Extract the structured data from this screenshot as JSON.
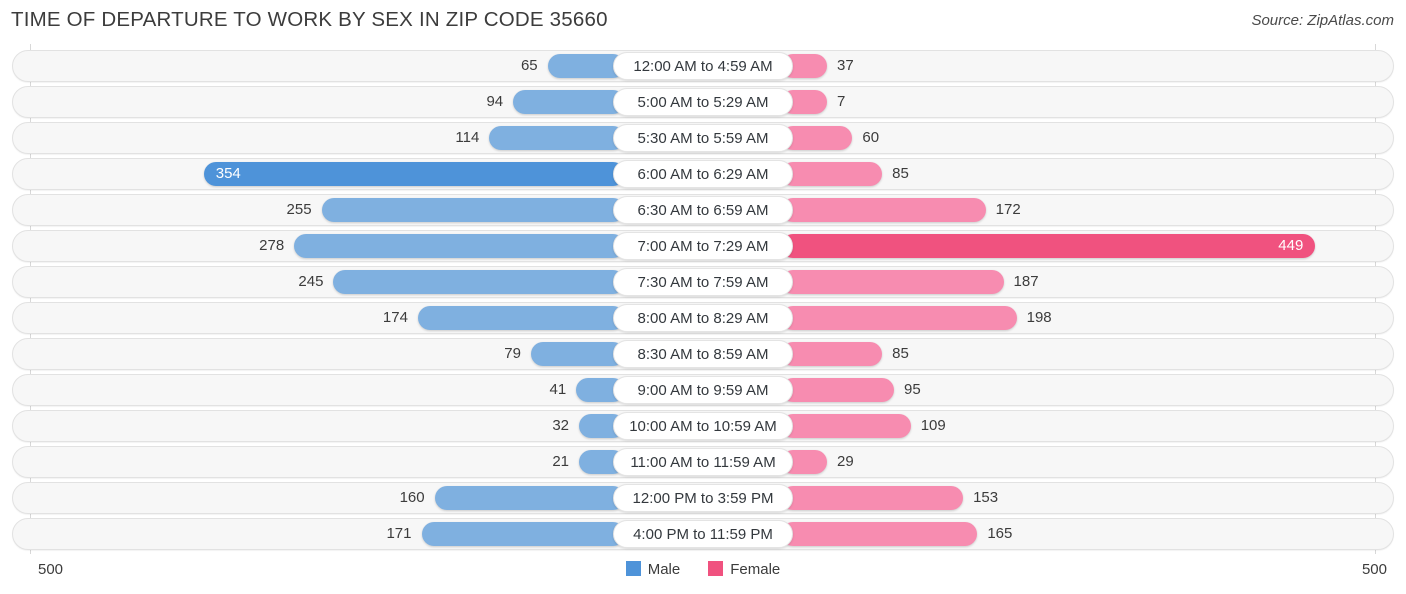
{
  "header": {
    "title": "TIME OF DEPARTURE TO WORK BY SEX IN ZIP CODE 35660",
    "source": "Source: ZipAtlas.com"
  },
  "axis": {
    "left_label": "500",
    "right_label": "500",
    "max": 500
  },
  "legend": {
    "items": [
      {
        "label": "Male",
        "color": "#4e93d9"
      },
      {
        "label": "Female",
        "color": "#f0527f"
      }
    ]
  },
  "colors": {
    "male": "#7fb0e0",
    "male_max": "#4e93d9",
    "female": "#f78cb0",
    "female_max": "#f0527f",
    "track": "#f7f7f7",
    "gridline": "#d8d8d8"
  },
  "chart_data": {
    "type": "bar",
    "title": "TIME OF DEPARTURE TO WORK BY SEX IN ZIP CODE 35660",
    "subtitle": "",
    "xlabel": "",
    "ylabel": "",
    "orientation": "horizontal-diverging",
    "xlim": [
      0,
      500
    ],
    "grid": true,
    "legend_position": "bottom-center",
    "categories": [
      "12:00 AM to 4:59 AM",
      "5:00 AM to 5:29 AM",
      "5:30 AM to 5:59 AM",
      "6:00 AM to 6:29 AM",
      "6:30 AM to 6:59 AM",
      "7:00 AM to 7:29 AM",
      "7:30 AM to 7:59 AM",
      "8:00 AM to 8:29 AM",
      "8:30 AM to 8:59 AM",
      "9:00 AM to 9:59 AM",
      "10:00 AM to 10:59 AM",
      "11:00 AM to 11:59 AM",
      "12:00 PM to 3:59 PM",
      "4:00 PM to 11:59 PM"
    ],
    "series": [
      {
        "name": "Male",
        "side": "left",
        "values": [
          65,
          94,
          114,
          354,
          255,
          278,
          245,
          174,
          79,
          41,
          32,
          21,
          160,
          171
        ]
      },
      {
        "name": "Female",
        "side": "right",
        "values": [
          37,
          7,
          60,
          85,
          172,
          449,
          187,
          198,
          85,
          95,
          109,
          29,
          153,
          165
        ]
      }
    ]
  }
}
